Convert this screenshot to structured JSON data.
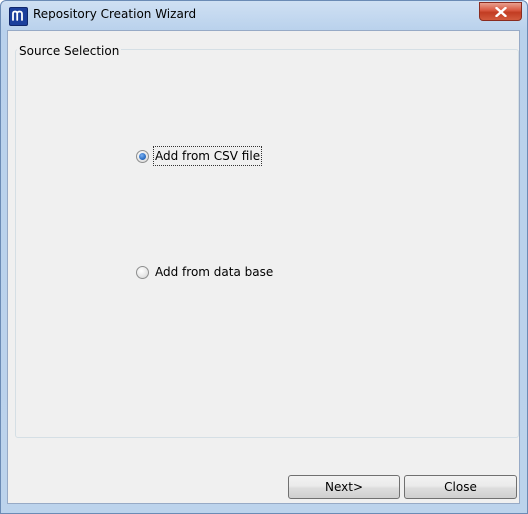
{
  "window": {
    "title": "Repository Creation Wizard",
    "close_glyph": "✕"
  },
  "group": {
    "label": "Source Selection"
  },
  "options": [
    {
      "label": "Add from CSV file",
      "checked": true
    },
    {
      "label": "Add from data base",
      "checked": false
    }
  ],
  "buttons": {
    "next_label": "Next>",
    "close_label": "Close"
  },
  "icons": {
    "app": "app-logo-icon",
    "close": "close-icon"
  },
  "colors": {
    "title_bar": "#b9d1ec",
    "client_bg": "#f0f0f0",
    "close_button": "#c23c22",
    "radio_dot": "#2d6fc4"
  }
}
